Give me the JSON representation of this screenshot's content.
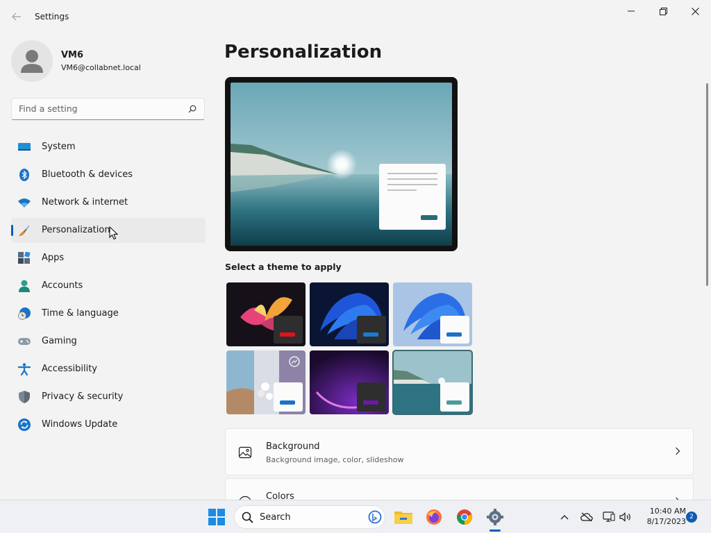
{
  "window": {
    "title": "Settings"
  },
  "profile": {
    "name": "VM6",
    "email": "VM6@collabnet.local"
  },
  "search": {
    "placeholder": "Find a setting"
  },
  "nav": {
    "items": [
      {
        "label": "System",
        "icon": "monitor-icon"
      },
      {
        "label": "Bluetooth & devices",
        "icon": "bluetooth-icon"
      },
      {
        "label": "Network & internet",
        "icon": "wifi-icon"
      },
      {
        "label": "Personalization",
        "icon": "paintbrush-icon",
        "selected": true
      },
      {
        "label": "Apps",
        "icon": "apps-icon"
      },
      {
        "label": "Accounts",
        "icon": "person-icon"
      },
      {
        "label": "Time & language",
        "icon": "globe-clock-icon"
      },
      {
        "label": "Gaming",
        "icon": "gamepad-icon"
      },
      {
        "label": "Accessibility",
        "icon": "accessibility-icon"
      },
      {
        "label": "Privacy & security",
        "icon": "shield-icon"
      },
      {
        "label": "Windows Update",
        "icon": "update-icon"
      }
    ]
  },
  "main": {
    "title": "Personalization",
    "themes_label": "Select a theme to apply",
    "cards": [
      {
        "title": "Background",
        "subtitle": "Background image, color, slideshow",
        "icon": "image-icon"
      },
      {
        "title": "Colors",
        "subtitle": "",
        "icon": "palette-icon"
      }
    ]
  },
  "taskbar": {
    "search_label": "Search",
    "time": "10:40 AM",
    "date": "8/17/2023",
    "notification_count": "2"
  },
  "colors": {
    "accent": "#005fb8",
    "sidebar_bg": "#f3f3f3",
    "card_bg": "#fbfbfb"
  }
}
